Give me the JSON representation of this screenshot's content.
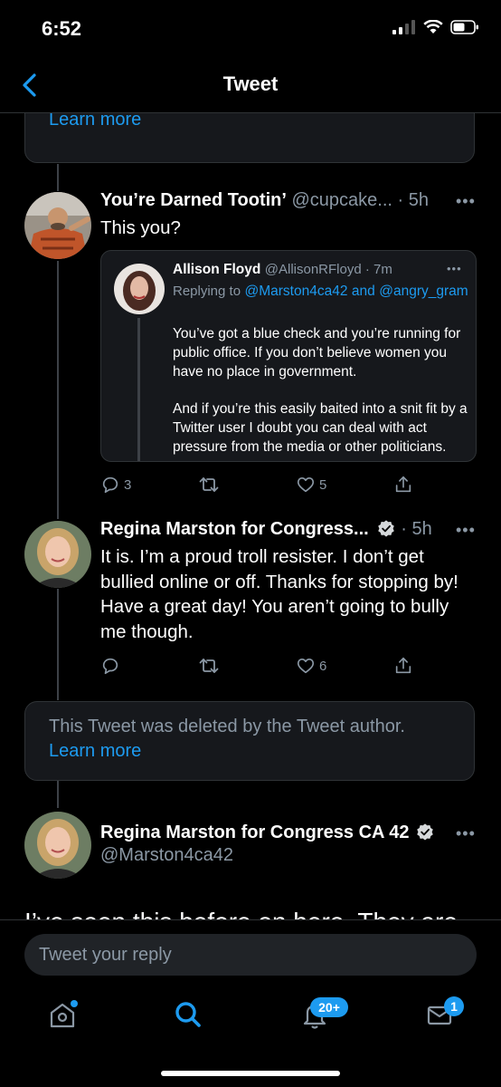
{
  "status_bar": {
    "time": "6:52"
  },
  "nav": {
    "title": "Tweet"
  },
  "deleted_notice": {
    "text": "This Tweet was deleted by the Tweet author.",
    "learn_more": "Learn more"
  },
  "tweets": [
    {
      "name": "You’re Darned Tootin’",
      "handle": "@cupcake...",
      "time": "5h",
      "text": "This you?",
      "quote": {
        "name": "Allison Floyd",
        "handle": "@AllisonRFloyd",
        "time": "7m",
        "replying_prefix": "Replying to",
        "replying_to_1": "@Marston4ca42",
        "and": "and",
        "replying_to_2": "@angry_gram",
        "paragraph_1": "You’ve got a blue check and you’re running for public office. If you don’t believe women you have no place in government.",
        "paragraph_2": "And if you’re this easily baited into a snit fit by a Twitter user I doubt you can deal with act pressure from the media or other politicians."
      },
      "replies": "3",
      "retweets": "",
      "likes": "5"
    },
    {
      "name": "Regina Marston for Congress...",
      "verified": true,
      "time": "5h",
      "text": "It is. I’m a proud troll resister. I don’t get bullied online or off. Thanks for stopping by! Have a great day! You aren’t going to bully me though.",
      "replies": "",
      "retweets": "",
      "likes": "6"
    },
    {
      "name": "Regina Marston for Congress CA 42",
      "verified": true,
      "handle": "@Marston4ca42",
      "text": "I’ve seen this before on here. They are"
    }
  ],
  "reply_bar": {
    "placeholder": "Tweet your reply"
  },
  "tab_bar": {
    "notifications_badge": "20+",
    "messages_badge": "1"
  },
  "colors": {
    "accent": "#1d9bf0",
    "background": "#000000",
    "card": "#16181c",
    "muted": "#8b98a5"
  }
}
